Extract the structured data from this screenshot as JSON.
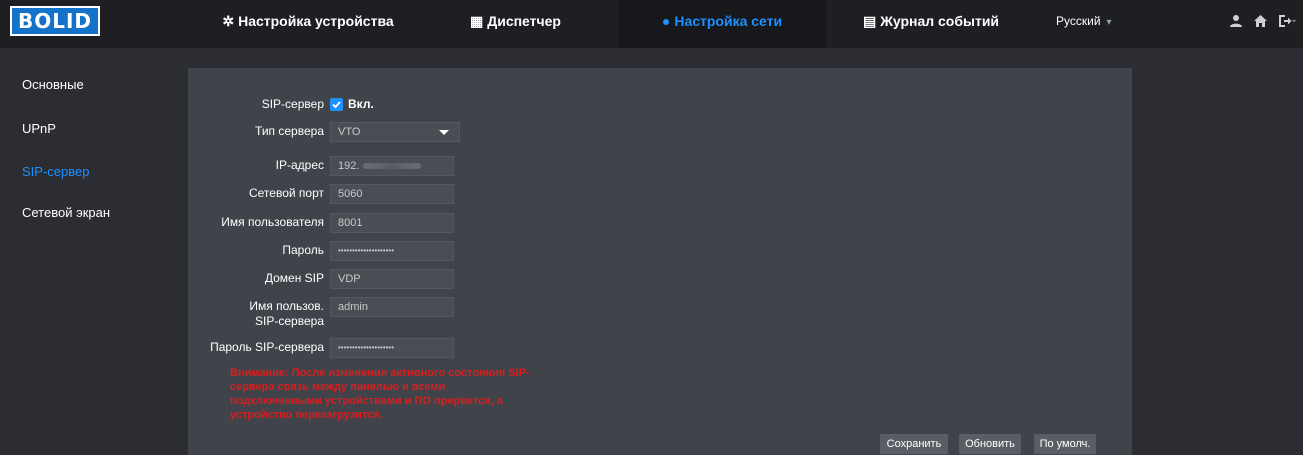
{
  "logo": {
    "text": "BOLID"
  },
  "nav": {
    "items": [
      {
        "icon": "✲",
        "label": "Настройка устройства"
      },
      {
        "icon": "▦",
        "label": "Диспетчер"
      },
      {
        "icon": "●",
        "label": "Настройка сети"
      },
      {
        "icon": "▤",
        "label": "Журнал событий"
      }
    ],
    "language": "Русский",
    "active_index": 2
  },
  "header_icons": [
    "user-icon",
    "home-icon",
    "logout-icon"
  ],
  "sidebar": {
    "items": [
      {
        "label": "Основные"
      },
      {
        "label": "UPnP"
      },
      {
        "label": "SIP-сервер"
      },
      {
        "label": "Сетевой экран"
      }
    ],
    "active_index": 2
  },
  "form": {
    "sip_server_label": "SIP-сервер",
    "sip_server_checkbox_label": "Вкл.",
    "sip_server_enabled": true,
    "server_type_label": "Тип сервера",
    "server_type_value": "VTO",
    "ip_label": "IP-адрес",
    "ip_value": "192.",
    "port_label": "Сетевой порт",
    "port_value": "5060",
    "username_label": "Имя пользователя",
    "username_value": "8001",
    "password_label": "Пароль",
    "password_value": "••••••••••••••••••••",
    "domain_label": "Домен SIP",
    "domain_value": "VDP",
    "sip_user_label": "Имя пользов. SIP-сервера",
    "sip_user_value": "admin",
    "sip_password_label": "Пароль SIP-сервера",
    "sip_password_value": "••••••••••••••••••••"
  },
  "warning": "Внимание: После изменения активного состояния SIP-сервера связь между панелью и всеми подключенными устройствами и ПО прервется, а устройство перезагрузится.",
  "buttons": {
    "save": "Сохранить",
    "refresh": "Обновить",
    "default": "По умолч."
  },
  "colors": {
    "accent": "#1e90ff",
    "warning": "#d81e1e",
    "topbar": "#1d1f23",
    "panel": "#404349",
    "page": "#2b2d33"
  }
}
